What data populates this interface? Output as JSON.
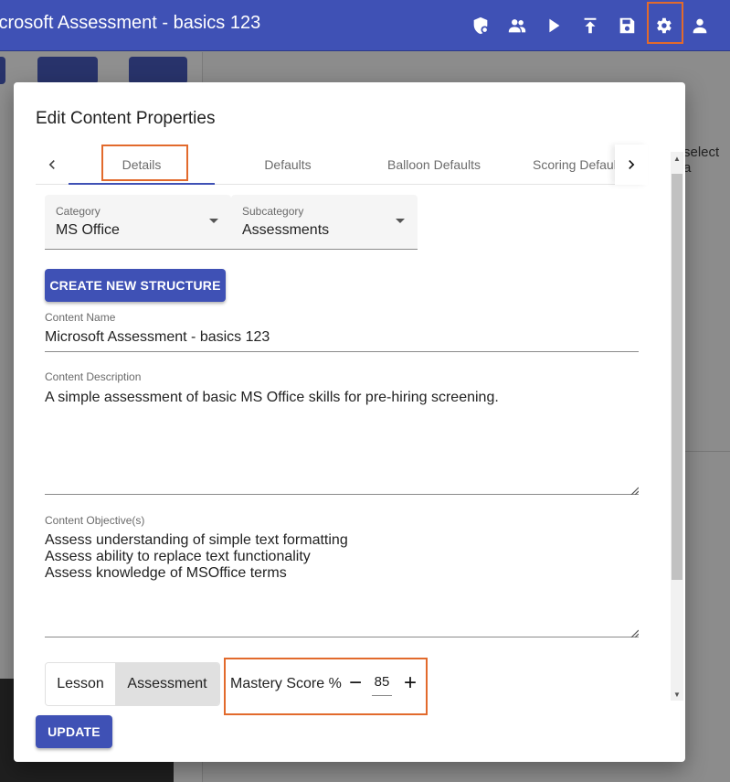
{
  "app": {
    "title": "icrosoft Assessment - basics 123"
  },
  "toolbar": {
    "icons": [
      "shield-settings-icon",
      "people-icon",
      "play-icon",
      "publish-icon",
      "save-icon",
      "gear-icon",
      "account-icon"
    ]
  },
  "background": {
    "select_text": "select a"
  },
  "modal": {
    "title": "Edit Content Properties",
    "tabs": [
      {
        "label": "Details"
      },
      {
        "label": "Defaults"
      },
      {
        "label": "Balloon Defaults"
      },
      {
        "label": "Scoring Defaul"
      }
    ],
    "category": {
      "label": "Category",
      "value": "MS Office"
    },
    "subcategory": {
      "label": "Subcategory",
      "value": "Assessments"
    },
    "create_structure_label": "CREATE NEW STRUCTURE",
    "content_name": {
      "label": "Content Name",
      "value": "Microsoft Assessment - basics 123"
    },
    "content_description": {
      "label": "Content Description",
      "value": "A simple assessment of basic MS Office skills for pre-hiring screening."
    },
    "content_objectives": {
      "label": "Content Objective(s)",
      "value": "Assess understanding of simple text formatting\nAssess ability to replace text functionality\nAssess knowledge of MSOffice terms"
    },
    "type_toggle": {
      "options": [
        "Lesson",
        "Assessment"
      ],
      "selected": "Assessment"
    },
    "mastery": {
      "label": "Mastery Score %",
      "value": "85"
    },
    "update_label": "UPDATE"
  },
  "colors": {
    "primary": "#3f51b5",
    "highlight": "#e26a2c"
  }
}
